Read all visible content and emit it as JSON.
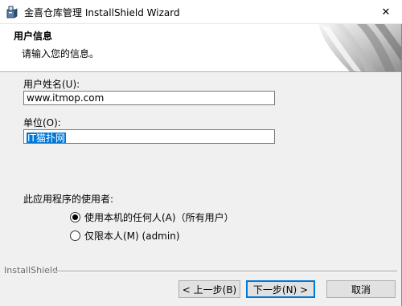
{
  "window": {
    "title": "金喜仓库管理 InstallShield Wizard",
    "close_glyph": "✕"
  },
  "header": {
    "heading": "用户信息",
    "subheading": "请输入您的信息。"
  },
  "form": {
    "username_label": "用户姓名(U):",
    "username_value": "www.itmop.com",
    "organization_label": "单位(O):",
    "organization_value": "IT猫扑网"
  },
  "install_for": {
    "label": "此应用程序的使用者:",
    "options": [
      {
        "label": "使用本机的任何人(A)（所有用户）",
        "selected": true
      },
      {
        "label": "仅限本人(M) (admin)",
        "selected": false
      }
    ]
  },
  "footer": {
    "brand": "InstallShield"
  },
  "buttons": {
    "back": "< 上一步(B)",
    "next": "下一步(N) >",
    "cancel": "取消"
  },
  "colors": {
    "selection": "#0078d7",
    "default_button_border": "#0078d7",
    "dialog_bg": "#f0f0f0"
  },
  "icons": {
    "app": "installer-box-icon",
    "close": "close-icon",
    "banner": "page-curl-banner"
  }
}
